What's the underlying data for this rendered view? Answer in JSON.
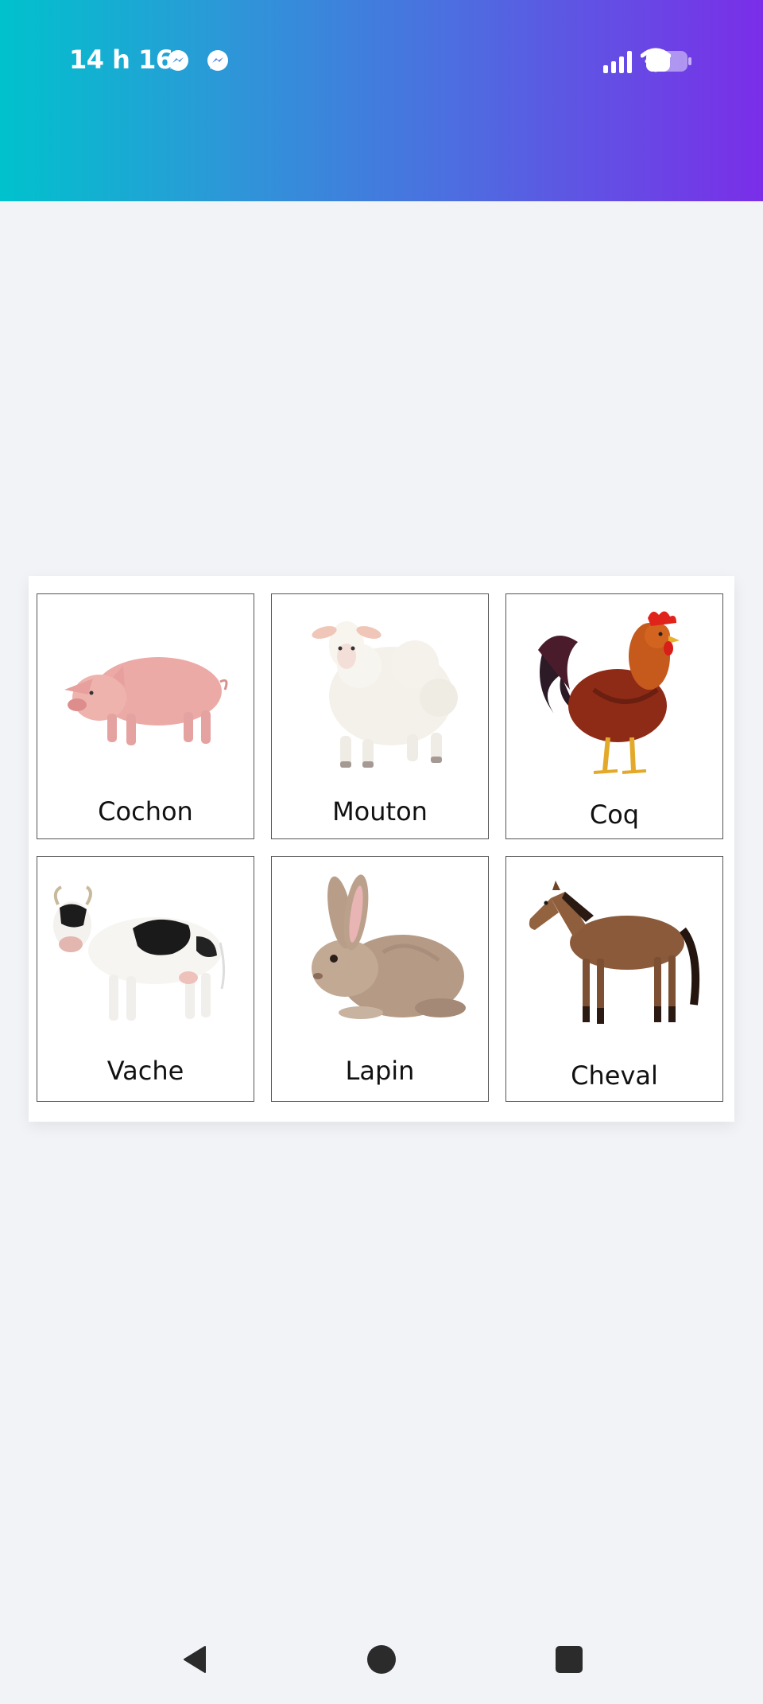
{
  "status_bar": {
    "time": "14 h 16",
    "notification_icons": [
      "messenger-icon",
      "messenger-icon"
    ],
    "system_icons": [
      "signal-icon",
      "wifi-icon",
      "battery-icon"
    ]
  },
  "cards": [
    {
      "label": "Cochon",
      "image": "pig-illustration"
    },
    {
      "label": "Mouton",
      "image": "sheep-illustration"
    },
    {
      "label": "Coq",
      "image": "rooster-illustration"
    },
    {
      "label": "Vache",
      "image": "cow-illustration"
    },
    {
      "label": "Lapin",
      "image": "rabbit-illustration"
    },
    {
      "label": "Cheval",
      "image": "horse-illustration"
    }
  ],
  "nav_bar": {
    "buttons": [
      "back-icon",
      "home-icon",
      "recents-icon"
    ]
  },
  "colors": {
    "gradient_start": "#00c2cc",
    "gradient_end": "#7a2ee8",
    "background": "#f1f3f7",
    "card_border": "#555555"
  }
}
